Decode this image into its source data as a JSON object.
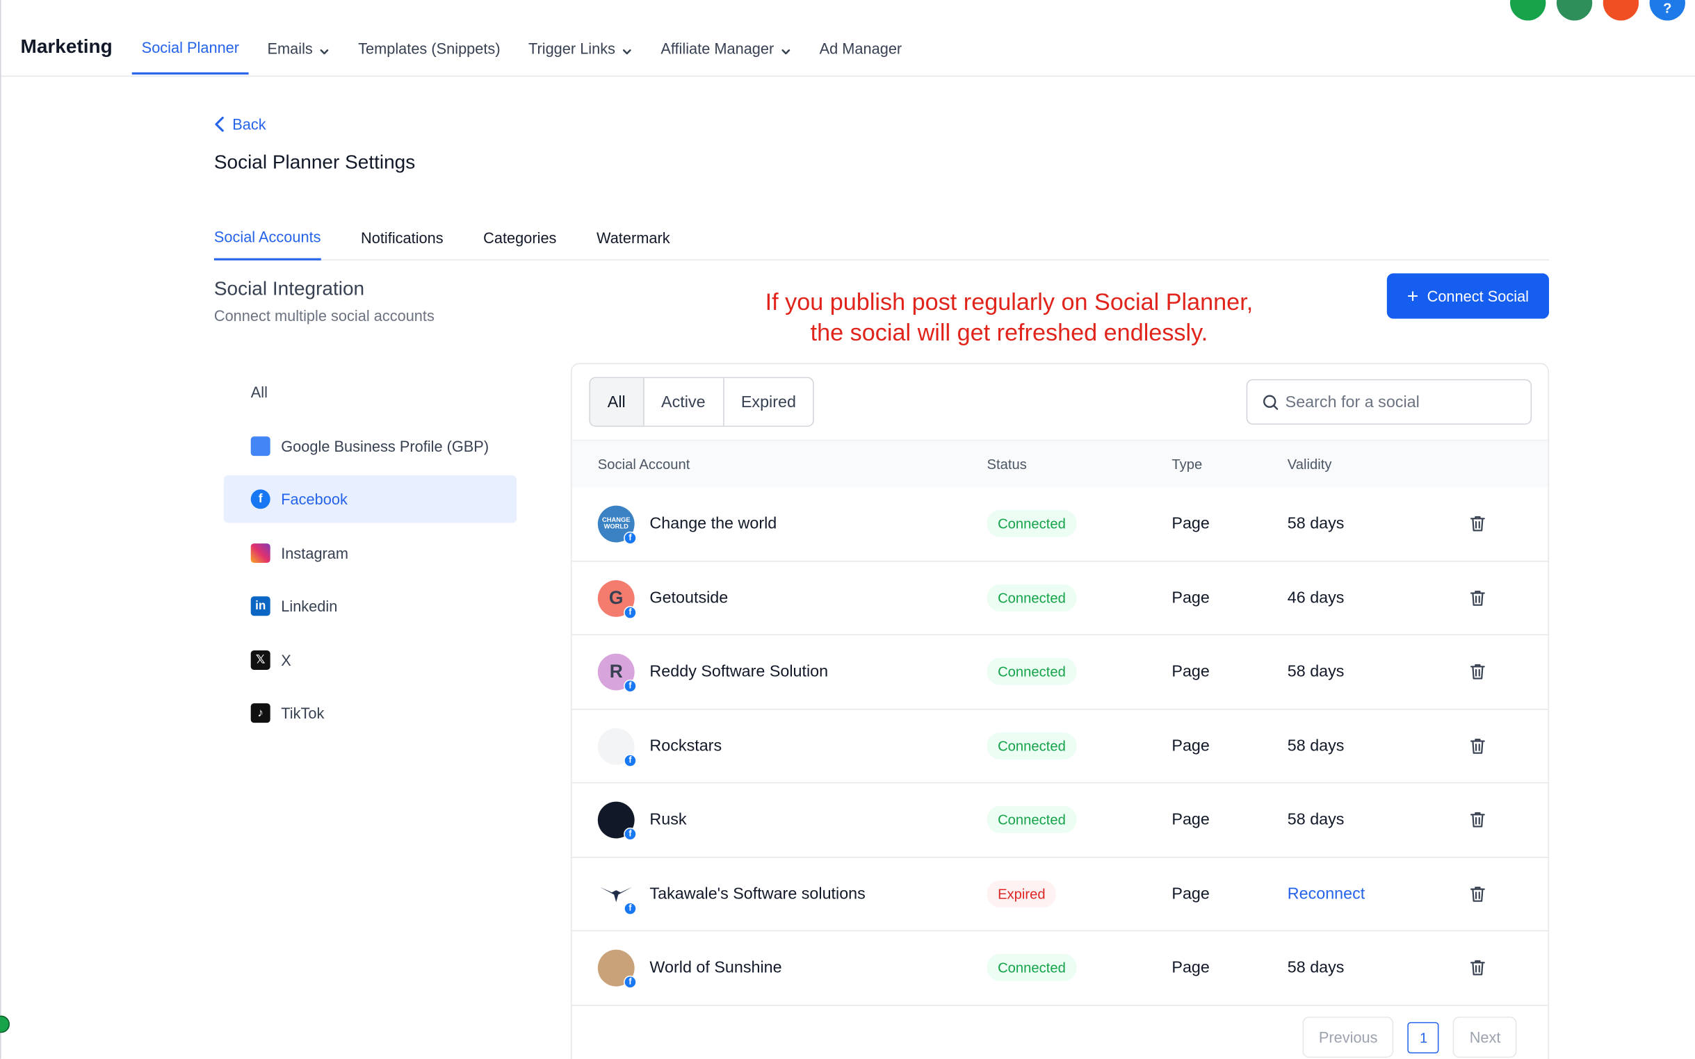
{
  "app": {
    "brand": "Marketing",
    "nav": [
      {
        "label": "Social Planner",
        "active": true,
        "dropdown": false
      },
      {
        "label": "Emails",
        "active": false,
        "dropdown": true
      },
      {
        "label": "Templates (Snippets)",
        "active": false,
        "dropdown": false
      },
      {
        "label": "Trigger Links",
        "active": false,
        "dropdown": true
      },
      {
        "label": "Affiliate Manager",
        "active": false,
        "dropdown": true
      },
      {
        "label": "Ad Manager",
        "active": false,
        "dropdown": false
      }
    ],
    "top_icons": [
      {
        "icon": "phone-icon",
        "color": "#16a34a"
      },
      {
        "icon": "megaphone-icon",
        "color": "#2f8f5b"
      },
      {
        "icon": "bell-icon",
        "color": "#f04f23"
      },
      {
        "icon": "help-icon",
        "color": "#1d7ae8",
        "glyph": "?"
      }
    ]
  },
  "header": {
    "back_label": "Back",
    "title": "Social Planner Settings"
  },
  "tabs": [
    {
      "label": "Social Accounts",
      "active": true
    },
    {
      "label": "Notifications",
      "active": false
    },
    {
      "label": "Categories",
      "active": false
    },
    {
      "label": "Watermark",
      "active": false
    }
  ],
  "section": {
    "title": "Social Integration",
    "subtitle": "Connect multiple social accounts",
    "connect_label": "Connect Social",
    "annotation_line1": "If you publish post regularly on Social Planner,",
    "annotation_line2": "the social will get refreshed endlessly."
  },
  "platforms": [
    {
      "label": "All",
      "icon": "",
      "active": false
    },
    {
      "label": "Google Business Profile (GBP)",
      "icon": "gbp-icon",
      "active": false
    },
    {
      "label": "Facebook",
      "icon": "facebook-icon",
      "active": true
    },
    {
      "label": "Instagram",
      "icon": "instagram-icon",
      "active": false
    },
    {
      "label": "Linkedin",
      "icon": "linkedin-icon",
      "active": false
    },
    {
      "label": "X",
      "icon": "x-icon",
      "active": false
    },
    {
      "label": "TikTok",
      "icon": "tiktok-icon",
      "active": false
    }
  ],
  "filters": [
    {
      "label": "All",
      "active": true
    },
    {
      "label": "Active",
      "active": false
    },
    {
      "label": "Expired",
      "active": false
    }
  ],
  "search": {
    "placeholder": "Search for a social",
    "value": ""
  },
  "table": {
    "columns": [
      "Social Account",
      "Status",
      "Type",
      "Validity"
    ],
    "rows": [
      {
        "name": "Change the world",
        "status": "Connected",
        "state": "ok",
        "type": "Page",
        "validity": "58 days",
        "avatar_text": "CHANGE WORLD",
        "avatar_color": "#3b82c4"
      },
      {
        "name": "Getoutside",
        "status": "Connected",
        "state": "ok",
        "type": "Page",
        "validity": "46 days",
        "avatar_text": "G",
        "avatar_color": "#f47c6f"
      },
      {
        "name": "Reddy Software Solution",
        "status": "Connected",
        "state": "ok",
        "type": "Page",
        "validity": "58 days",
        "avatar_text": "R",
        "avatar_color": "#d8a4dc"
      },
      {
        "name": "Rockstars",
        "status": "Connected",
        "state": "ok",
        "type": "Page",
        "validity": "58 days",
        "avatar_text": "",
        "avatar_color": "#f3f4f6"
      },
      {
        "name": "Rusk",
        "status": "Connected",
        "state": "ok",
        "type": "Page",
        "validity": "58 days",
        "avatar_text": "",
        "avatar_color": "#111827"
      },
      {
        "name": "Takawale's Software solutions",
        "status": "Expired",
        "state": "bad",
        "type": "Page",
        "validity": "Reconnect",
        "avatar_text": "",
        "avatar_color": "#ffffff"
      },
      {
        "name": "World of Sunshine",
        "status": "Connected",
        "state": "ok",
        "type": "Page",
        "validity": "58 days",
        "avatar_text": "",
        "avatar_color": "#c9a27a"
      }
    ]
  },
  "pagination": {
    "previous": "Previous",
    "page": "1",
    "next": "Next"
  }
}
